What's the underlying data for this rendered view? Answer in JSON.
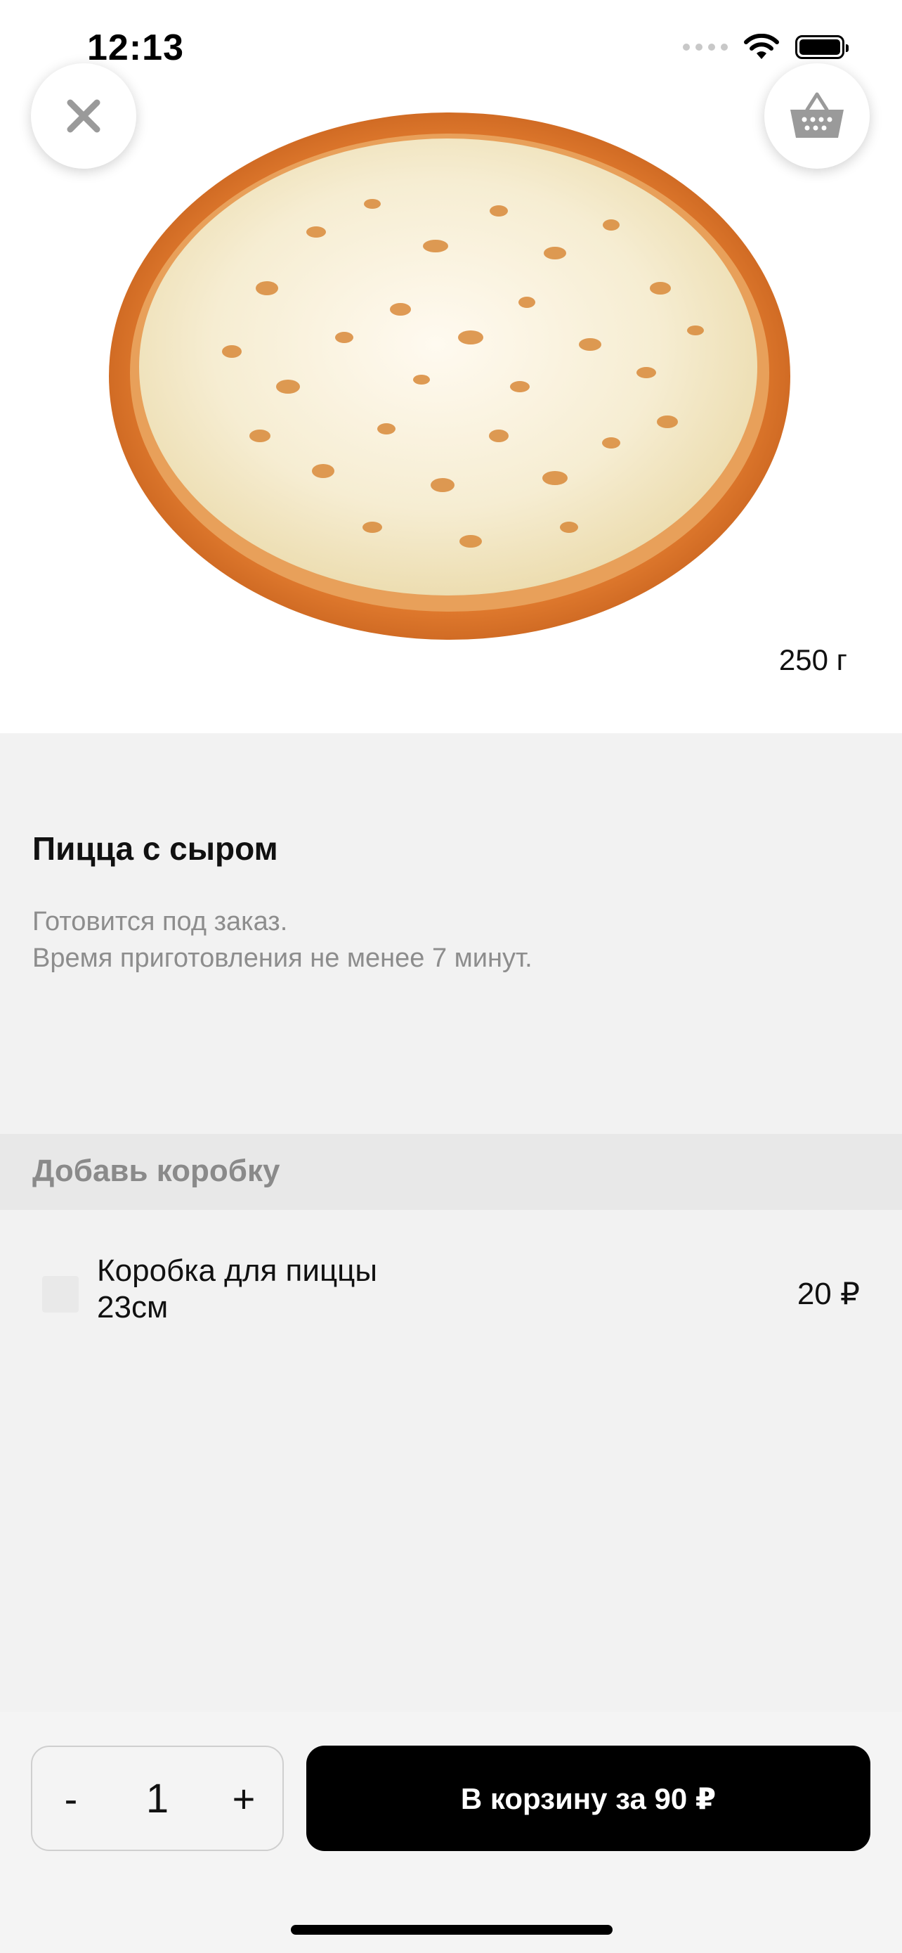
{
  "status_bar": {
    "time": "12:13"
  },
  "hero": {
    "weight": "250 г"
  },
  "icons": {
    "close": "close-icon",
    "cart": "basket-icon",
    "wifi": "wifi-icon",
    "battery": "battery-icon"
  },
  "product": {
    "title": "Пицца с сыром",
    "description_line1": "Готовится под заказ.",
    "description_line2": "Время приготовления не менее 7 минут."
  },
  "addons": {
    "section_title": "Добавь коробку",
    "items": [
      {
        "name": "Коробка для пиццы 23см",
        "price": "20 ₽",
        "checked": false
      }
    ]
  },
  "order": {
    "minus_label": "-",
    "quantity": "1",
    "plus_label": "+",
    "add_to_cart_label": "В корзину за 90 ₽"
  },
  "colors": {
    "background": "#f2f2f2",
    "primary_button": "#000000",
    "muted_text": "#8d8d8d",
    "section_header_bg": "#e8e8e8"
  }
}
